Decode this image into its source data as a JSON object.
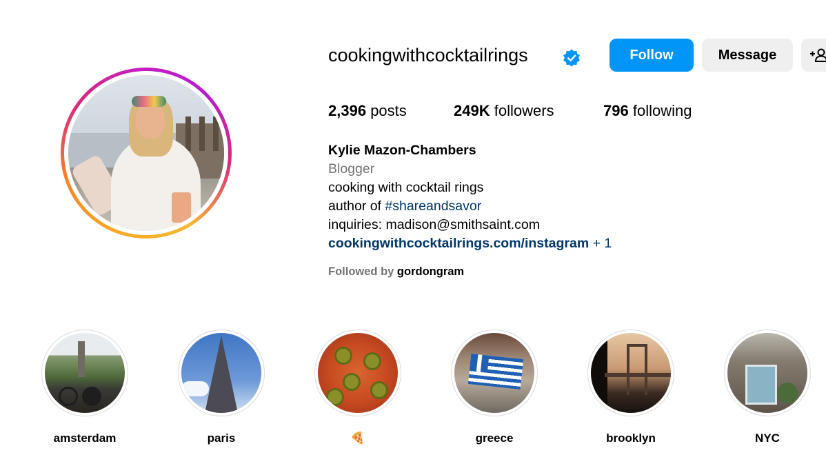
{
  "profile": {
    "username": "cookingwithcocktailrings",
    "verified": true,
    "follow_label": "Follow",
    "message_label": "Message",
    "suggest_icon": "person-plus-icon",
    "stats": {
      "posts_count": "2,396",
      "posts_label": "posts",
      "followers_count": "249K",
      "followers_label": "followers",
      "following_count": "796",
      "following_label": "following"
    },
    "bio": {
      "full_name": "Kylie Mazon-Chambers",
      "category": "Blogger",
      "line1": "cooking with cocktail rings",
      "line2_prefix": "author of ",
      "line2_hashtag": "#shareandsavor",
      "line3": "inquiries: madison@smithsaint.com",
      "link": "cookingwithcocktailrings.com/instagram",
      "link_more": " + 1"
    },
    "followed_by": {
      "prefix": "Followed by ",
      "user": "gordongram"
    }
  },
  "highlights": [
    {
      "label": "amsterdam"
    },
    {
      "label": "paris"
    },
    {
      "label": "🍕"
    },
    {
      "label": "greece"
    },
    {
      "label": "brooklyn"
    },
    {
      "label": "NYC"
    }
  ],
  "colors": {
    "follow_button": "#0095f6",
    "secondary_button": "#efefef",
    "link": "#00376b",
    "muted": "#737373",
    "verified_badge": "#0095f6"
  }
}
